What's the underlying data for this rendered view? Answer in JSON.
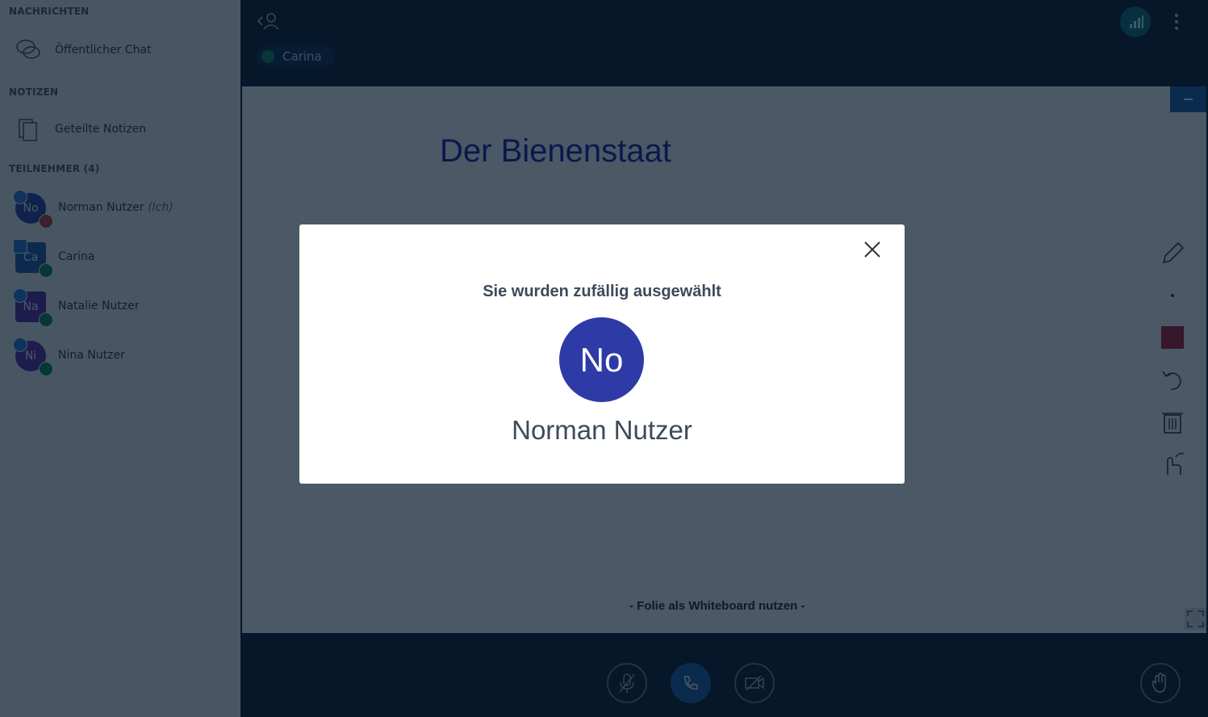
{
  "sidebar": {
    "messages_title": "NACHRICHTEN",
    "public_chat": "Öffentlicher Chat",
    "notes_title": "NOTIZEN",
    "shared_notes": "Geteilte Notizen",
    "participants_title": "TEILNEHMER (4)",
    "users": [
      {
        "initials": "No",
        "name": "Norman Nutzer",
        "suffix": "(Ich)",
        "color": "#2e3aa6"
      },
      {
        "initials": "Ca",
        "name": "Carina",
        "suffix": "",
        "color": "#1e5aa8"
      },
      {
        "initials": "Na",
        "name": "Natalie Nutzer",
        "suffix": "",
        "color": "#5a2aa8"
      },
      {
        "initials": "Ni",
        "name": "Nina Nutzer",
        "suffix": "",
        "color": "#5a2aa8"
      }
    ]
  },
  "topbar": {
    "talking_user": "Carina"
  },
  "presentation": {
    "slide_title": "Der Bienenstaat",
    "whiteboard_label": "- Folie als Whiteboard nutzen -"
  },
  "modal": {
    "title": "Sie wurden zufällig ausgewählt",
    "initials": "No",
    "name": "Norman Nutzer"
  },
  "colors": {
    "accent": "#1b5fad",
    "dark_bg": "#06172a",
    "tool_color": "#b01c33"
  }
}
